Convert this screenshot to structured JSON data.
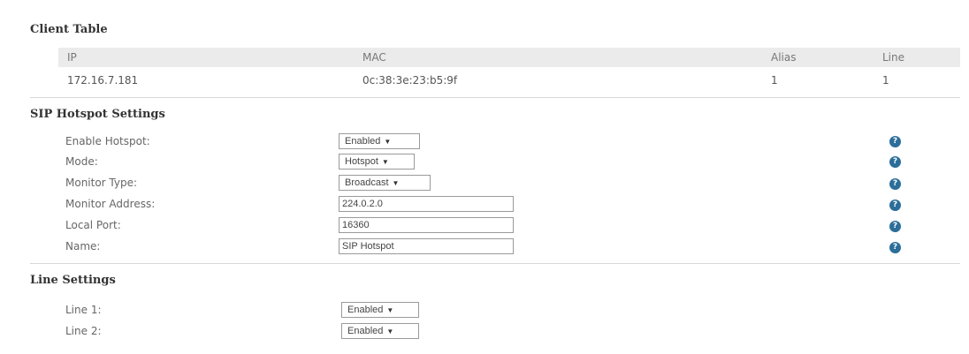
{
  "client_table": {
    "title": "Client Table",
    "headers": {
      "ip": "IP",
      "mac": "MAC",
      "alias": "Alias",
      "line": "Line"
    },
    "rows": [
      {
        "ip": "172.16.7.181",
        "mac": "0c:38:3e:23:b5:9f",
        "alias": "1",
        "line": "1"
      }
    ]
  },
  "sip_hotspot": {
    "title": "SIP Hotspot Settings",
    "enable_hotspot": {
      "label": "Enable Hotspot:",
      "value": "Enabled"
    },
    "mode": {
      "label": "Mode:",
      "value": "Hotspot"
    },
    "monitor_type": {
      "label": "Monitor Type:",
      "value": "Broadcast"
    },
    "monitor_address": {
      "label": "Monitor Address:",
      "value": "224.0.2.0"
    },
    "local_port": {
      "label": "Local Port:",
      "value": "16360"
    },
    "name": {
      "label": "Name:",
      "value": "SIP Hotspot"
    },
    "help_glyph": "?"
  },
  "line_settings": {
    "title": "Line Settings",
    "line1": {
      "label": "Line 1:",
      "value": "Enabled"
    },
    "line2": {
      "label": "Line 2:",
      "value": "Enabled"
    }
  },
  "caret_glyph": "▼",
  "colors": {
    "help_icon": "#2c6e9a",
    "table_header_bg": "#ebebeb"
  }
}
